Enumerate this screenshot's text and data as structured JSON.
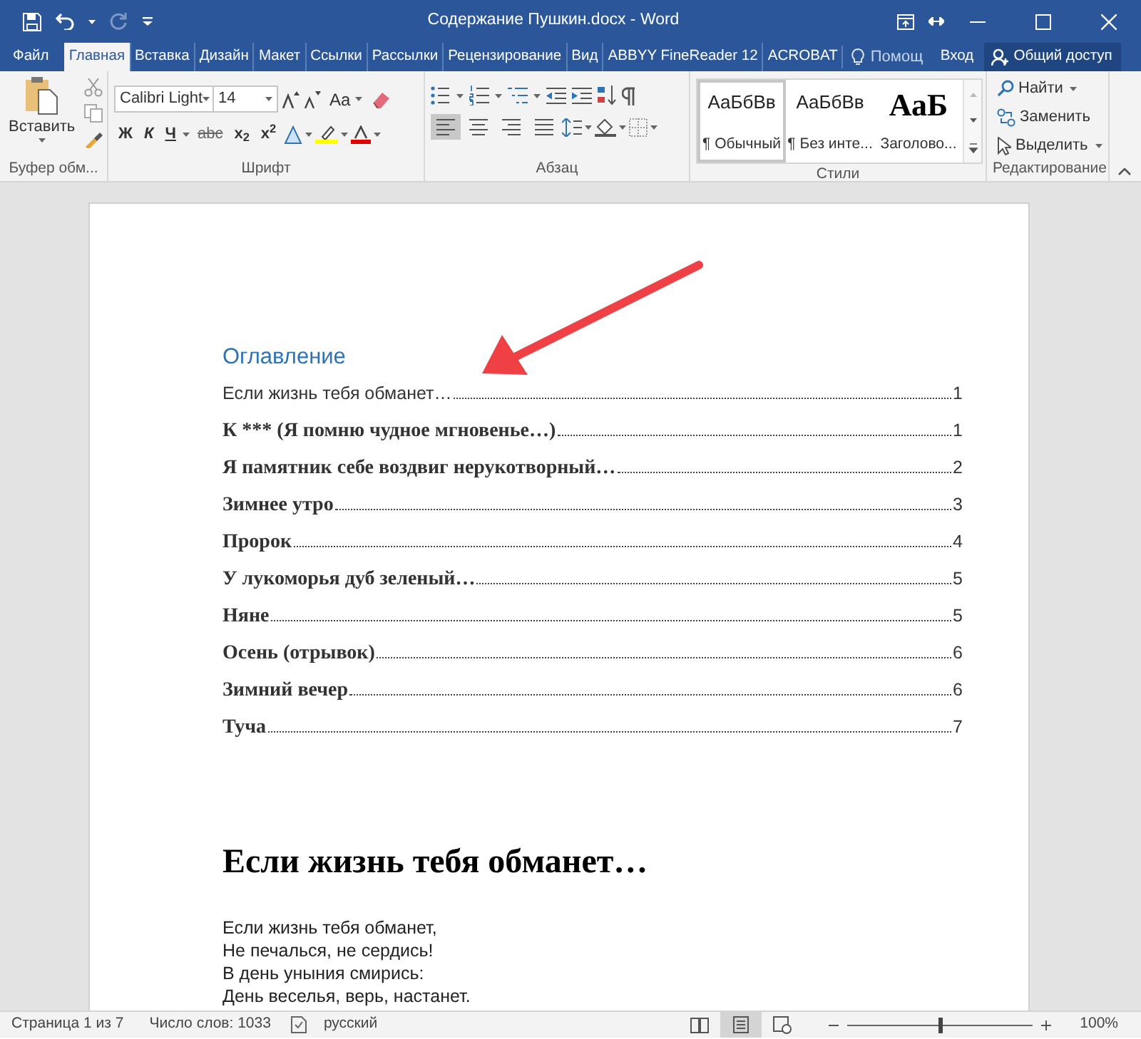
{
  "window": {
    "title": "Содержание Пушкин.docx - Word"
  },
  "quick_access": [
    {
      "kind": "save",
      "disabled": false
    },
    {
      "kind": "undo",
      "disabled": false
    },
    {
      "kind": "redo",
      "disabled": true
    }
  ],
  "tabs": [
    {
      "label": "Файл",
      "selected": false
    },
    {
      "label": "Главная",
      "selected": true
    },
    {
      "label": "Вставка",
      "selected": false
    },
    {
      "label": "Дизайн",
      "selected": false
    },
    {
      "label": "Макет",
      "selected": false
    },
    {
      "label": "Ссылки",
      "selected": false
    },
    {
      "label": "Рассылки",
      "selected": false
    },
    {
      "label": "Рецензирование",
      "selected": false
    },
    {
      "label": "Вид",
      "selected": false
    },
    {
      "label": "ABBYY FineReader 12",
      "selected": false
    },
    {
      "label": "ACROBAT",
      "selected": false
    }
  ],
  "tell_me": {
    "placeholder": "Помощ"
  },
  "sign_in": "Вход",
  "share_button": "Общий доступ",
  "ribbon": {
    "clipboard": {
      "paste_label": "Вставить",
      "group_label": "Буфер обм..."
    },
    "font": {
      "font_name": "Calibri Light",
      "font_size": "14",
      "change_case": "Aa",
      "group_label": "Шрифт",
      "format_buttons": [
        {
          "kind": "bold",
          "label": "Ж"
        },
        {
          "kind": "italic",
          "label": "К"
        },
        {
          "kind": "underline",
          "label": "Ч"
        },
        {
          "kind": "strike",
          "label": "abc"
        },
        {
          "kind": "script",
          "label": "x$_{2}$"
        },
        {
          "kind": "script",
          "label": "x$^{2}$"
        }
      ]
    },
    "paragraph": {
      "group_label": "Абзац",
      "alignments": [
        {
          "kind": "left",
          "selected": true
        },
        {
          "kind": "center",
          "selected": false
        },
        {
          "kind": "right",
          "selected": false
        },
        {
          "kind": "justify",
          "selected": false
        }
      ]
    },
    "styles": {
      "group_label": "Стили",
      "items": [
        {
          "preview": "АаБбВв",
          "name": "¶ Обычный",
          "kind": "normal",
          "selected": true
        },
        {
          "preview": "АаБбВв",
          "name": "¶ Без инте...",
          "kind": "normal",
          "selected": false
        },
        {
          "preview": "АаБ",
          "name": "Заголово...",
          "kind": "title",
          "selected": false
        }
      ]
    },
    "editing": {
      "group_label": "Редактирование",
      "items": [
        {
          "kind": "find",
          "label": "Найти"
        },
        {
          "kind": "replace",
          "label": "Заменить"
        },
        {
          "kind": "select",
          "label": "Выделить"
        }
      ]
    }
  },
  "document": {
    "toc_heading": "Оглавление",
    "toc_entries": [
      {
        "title": "Если жизнь тебя обманет…",
        "page": "1",
        "bold": false
      },
      {
        "title": "К *** (Я помню чудное мгновенье…)",
        "page": "1",
        "bold": true
      },
      {
        "title": "Я памятник себе воздвиг нерукотворный…",
        "page": "2",
        "bold": true
      },
      {
        "title": "Зимнее утро",
        "page": "3",
        "bold": true
      },
      {
        "title": "Пророк",
        "page": "4",
        "bold": true
      },
      {
        "title": "У лукоморья дуб зеленый…",
        "page": "5",
        "bold": true
      },
      {
        "title": "Няне",
        "page": "5",
        "bold": true
      },
      {
        "title": "Осень (отрывок)",
        "page": "6",
        "bold": true
      },
      {
        "title": "Зимний вечер",
        "page": "6",
        "bold": true
      },
      {
        "title": "Туча",
        "page": "7",
        "bold": true
      }
    ],
    "heading": "Если жизнь тебя обманет…",
    "poem_lines": [
      "Если жизнь тебя обманет,",
      "Не печалься, не сердись!",
      "В день уныния смирись:",
      "День веселья, верь, настанет."
    ]
  },
  "status_bar": {
    "page": "Страница 1 из 7",
    "words": "Число слов: 1033",
    "language": "русский",
    "views": [
      {
        "kind": "read",
        "selected": false
      },
      {
        "kind": "print",
        "selected": true
      },
      {
        "kind": "web",
        "selected": false
      }
    ],
    "zoom": {
      "level": 0.5,
      "reading": "100%"
    }
  }
}
